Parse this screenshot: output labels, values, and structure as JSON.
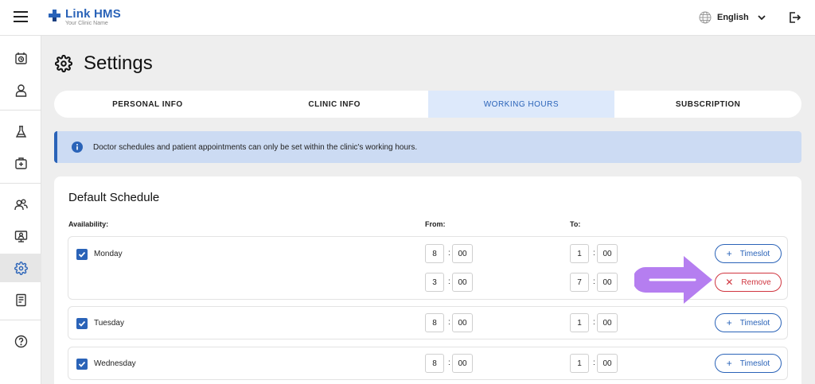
{
  "app": {
    "name": "Link HMS",
    "subtitle": "Your Clinic Name"
  },
  "header": {
    "language": "English"
  },
  "sidebar": {
    "items": [
      "appointments-icon",
      "patient-icon",
      "lab-icon",
      "medical-kit-icon",
      "staff-icon",
      "monitor-icon",
      "settings-icon",
      "report-icon",
      "help-icon"
    ],
    "active": "settings-icon"
  },
  "page": {
    "title": "Settings"
  },
  "tabs": [
    {
      "label": "PERSONAL INFO"
    },
    {
      "label": "CLINIC INFO"
    },
    {
      "label": "WORKING HOURS"
    },
    {
      "label": "SUBSCRIPTION"
    }
  ],
  "info": {
    "message": "Doctor schedules and patient appointments can only be set within the clinic's working hours."
  },
  "schedule": {
    "title": "Default Schedule",
    "headers": {
      "availability": "Availability:",
      "from": "From:",
      "to": "To:"
    },
    "colon": ":",
    "timeslot_label": "Timeslot",
    "remove_label": "Remove",
    "days": [
      {
        "name": "Monday",
        "checked": true,
        "slots": [
          {
            "from_h": "8",
            "from_m": "00",
            "to_h": "1",
            "to_m": "00"
          },
          {
            "from_h": "3",
            "from_m": "00",
            "to_h": "7",
            "to_m": "00"
          }
        ]
      },
      {
        "name": "Tuesday",
        "checked": true,
        "slots": [
          {
            "from_h": "8",
            "from_m": "00",
            "to_h": "1",
            "to_m": "00"
          }
        ]
      },
      {
        "name": "Wednesday",
        "checked": true,
        "slots": [
          {
            "from_h": "8",
            "from_m": "00",
            "to_h": "1",
            "to_m": "00"
          }
        ]
      }
    ]
  },
  "colors": {
    "accent": "#2a63b8",
    "danger": "#d0353f",
    "arrow": "#b57ef0",
    "active_tab_bg": "#dde9fb",
    "info_bg": "#ccdbf3"
  }
}
